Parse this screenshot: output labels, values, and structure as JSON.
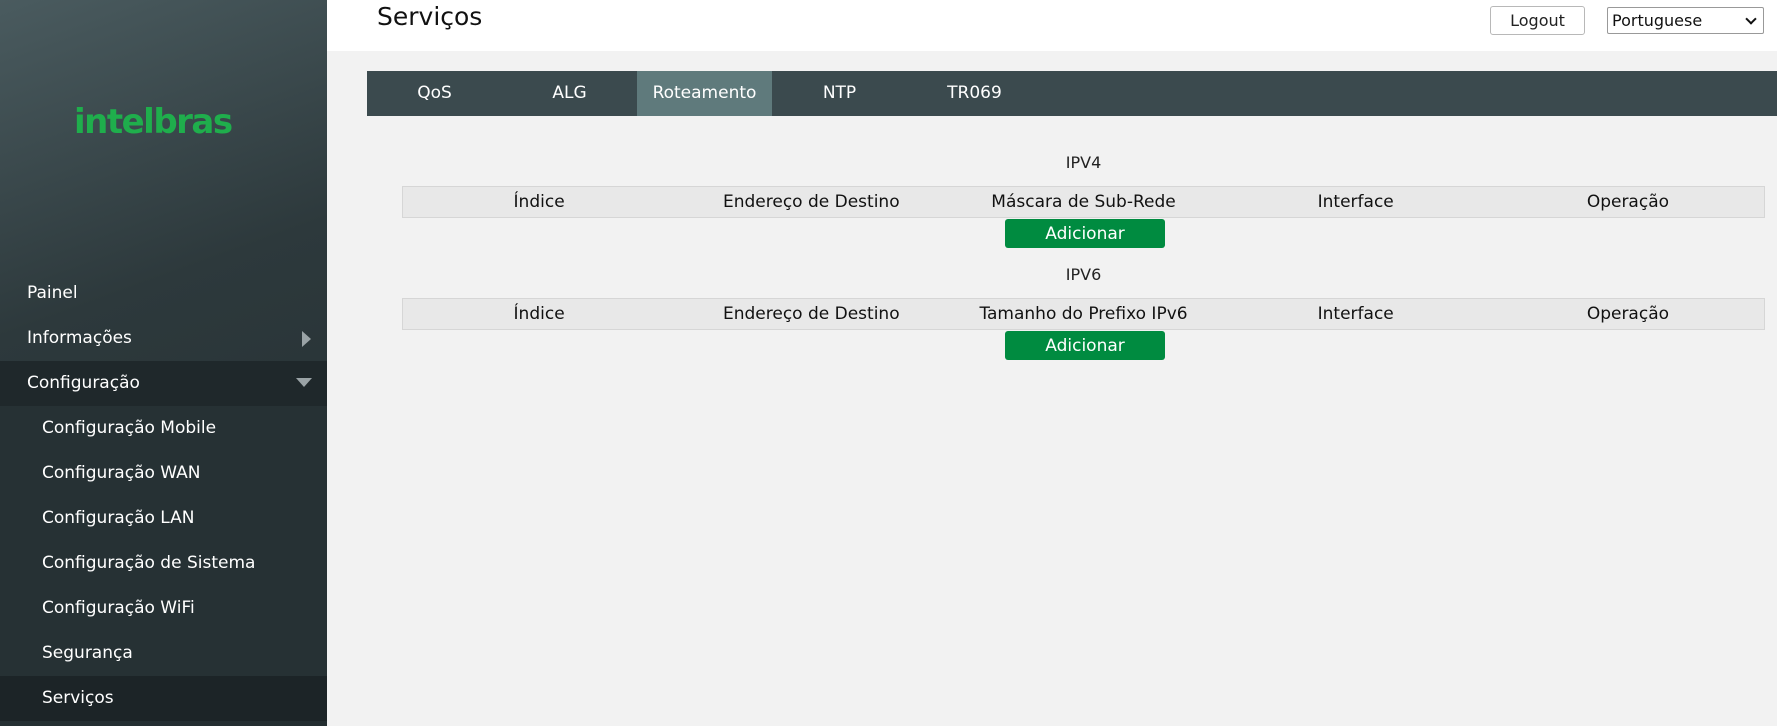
{
  "brand": {
    "logo_text": "intelbras",
    "color": "#1fae4c"
  },
  "header": {
    "title": "Serviços",
    "logout_label": "Logout",
    "language": {
      "selected": "Portuguese"
    }
  },
  "sidebar": {
    "items": [
      {
        "label": "Painel"
      },
      {
        "label": "Informações"
      },
      {
        "label": "Configuração"
      }
    ],
    "config_subitems": [
      {
        "label": "Configuração Mobile"
      },
      {
        "label": "Configuração WAN"
      },
      {
        "label": "Configuração LAN"
      },
      {
        "label": "Configuração de Sistema"
      },
      {
        "label": "Configuração WiFi"
      },
      {
        "label": "Segurança"
      },
      {
        "label": "Serviços"
      }
    ]
  },
  "tabs": [
    {
      "label": "QoS"
    },
    {
      "label": "ALG"
    },
    {
      "label": "Roteamento",
      "active": true
    },
    {
      "label": "NTP"
    },
    {
      "label": "TR069"
    }
  ],
  "ipv4": {
    "title": "IPV4",
    "columns": [
      "Índice",
      "Endereço de Destino",
      "Máscara de Sub-Rede",
      "Interface",
      "Operação"
    ],
    "add_label": "Adicionar"
  },
  "ipv6": {
    "title": "IPV6",
    "columns": [
      "Índice",
      "Endereço de Destino",
      "Tamanho do Prefixo IPv6",
      "Interface",
      "Operação"
    ],
    "add_label": "Adicionar"
  },
  "colors": {
    "accent_green": "#008b40",
    "tab_bar": "#3b4a4e",
    "tab_active": "#5f7a7c"
  }
}
